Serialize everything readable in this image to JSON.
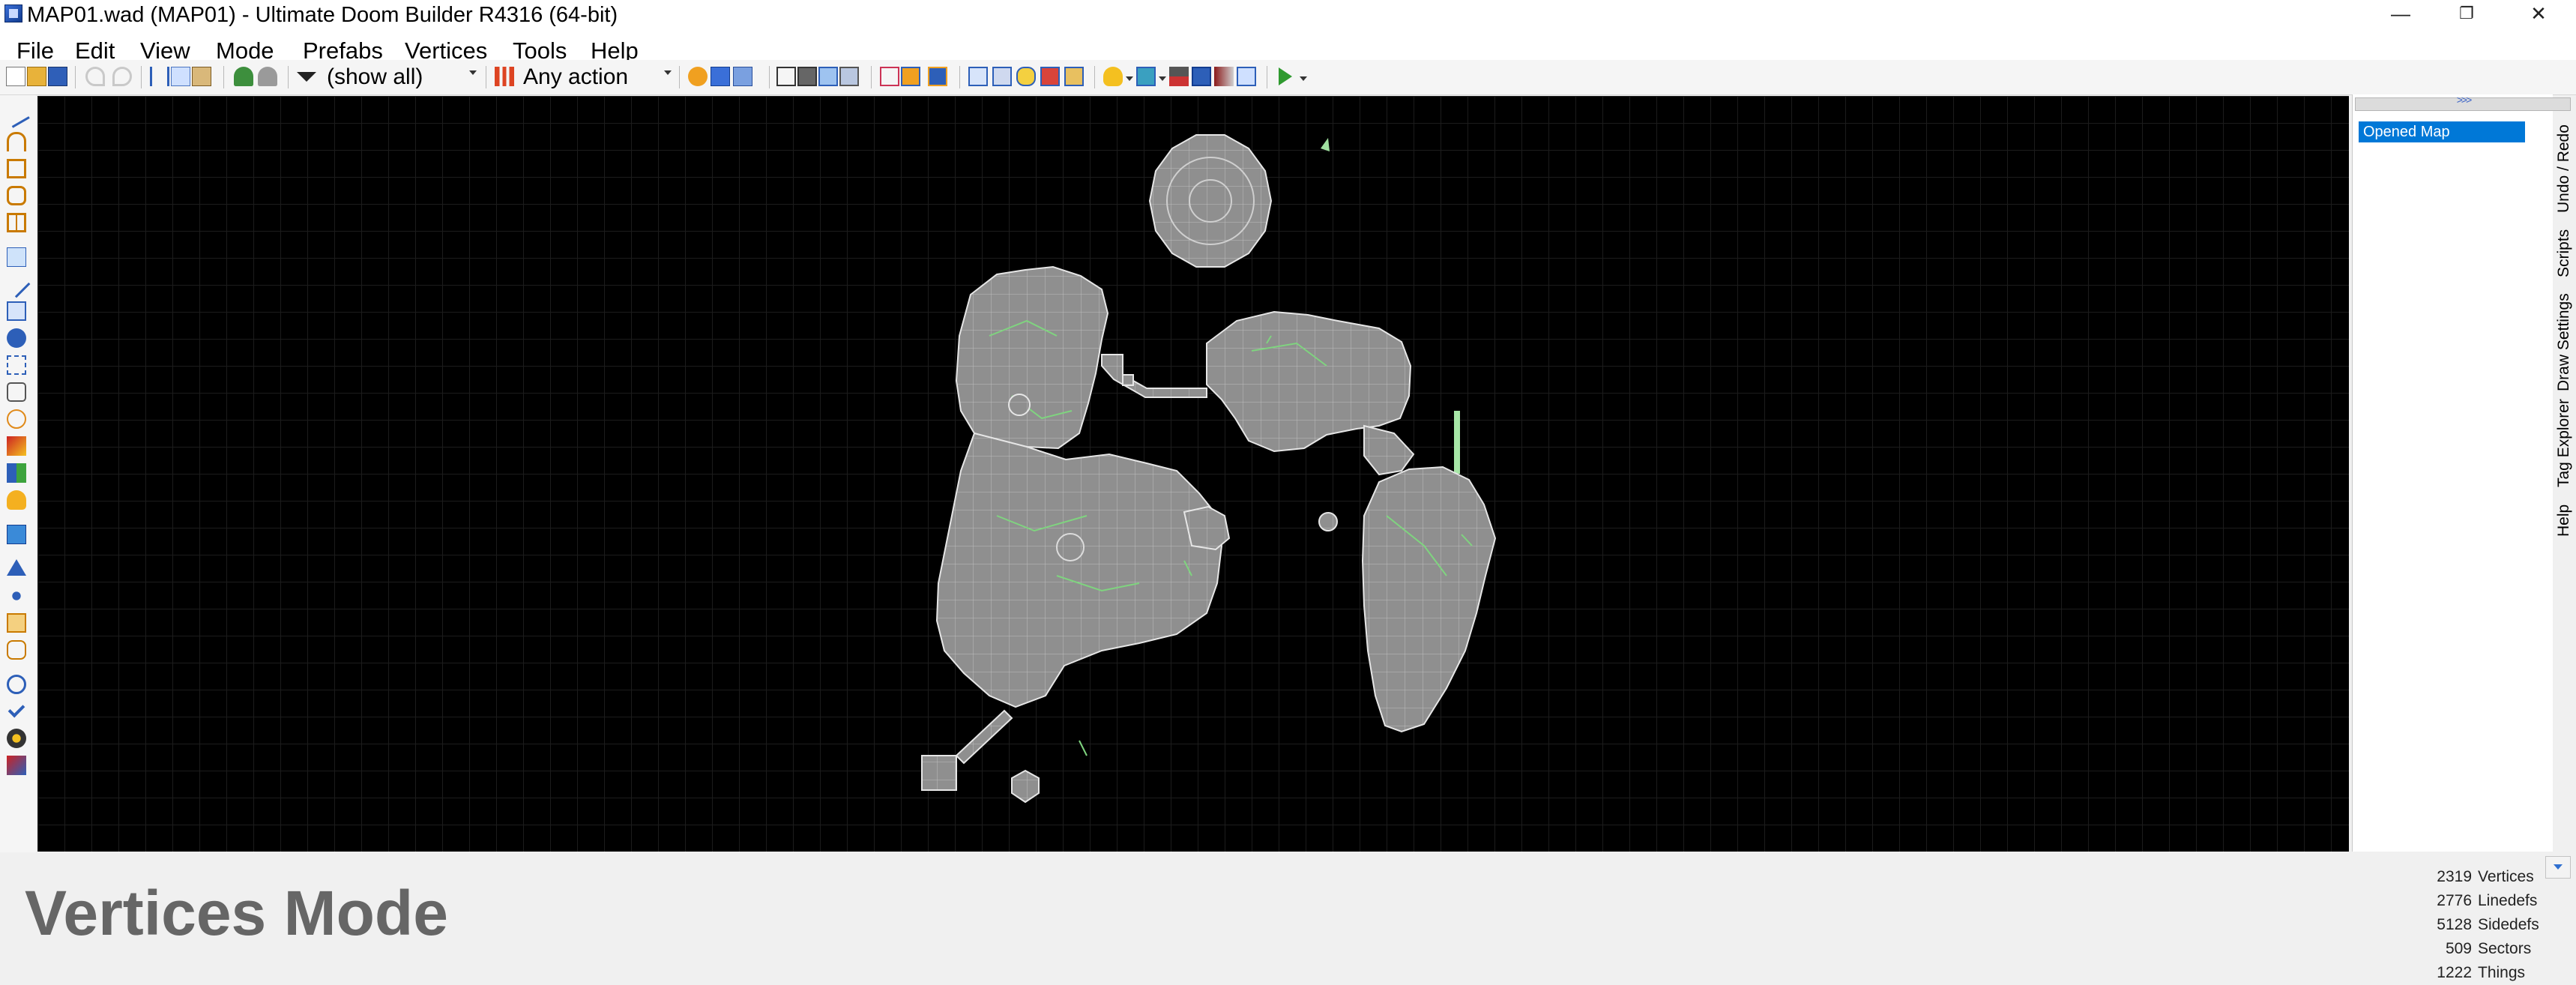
{
  "window": {
    "title": "MAP01.wad (MAP01) - Ultimate Doom Builder R4316 (64-bit)",
    "minimize_glyph": "—",
    "restore_glyph": "❐",
    "close_glyph": "✕"
  },
  "menu": {
    "items": [
      "File",
      "Edit",
      "View",
      "Mode",
      "Prefabs",
      "Vertices",
      "Tools",
      "Help"
    ]
  },
  "toolbar": {
    "filter_value": "(show all)",
    "action_value": "Any action"
  },
  "right_panel": {
    "undo_items": [
      "Opened Map"
    ],
    "tabs": [
      "Undo / Redo",
      "Scripts",
      "Draw Settings",
      "Tag Explorer",
      "Help"
    ]
  },
  "status": {
    "mode": "Vertices Mode",
    "stats": [
      {
        "value": "2319",
        "label": "Vertices"
      },
      {
        "value": "2776",
        "label": "Linedefs"
      },
      {
        "value": "5128",
        "label": "Sidedefs"
      },
      {
        "value": "509",
        "label": "Sectors"
      },
      {
        "value": "1222",
        "label": "Things"
      }
    ]
  },
  "colors": {
    "map_fill": "#8c8c8c",
    "map_line": "#e6e6e6",
    "map_detail": "#7fd47f",
    "grid": "#1c1c1c",
    "selection": "#0078d7"
  }
}
